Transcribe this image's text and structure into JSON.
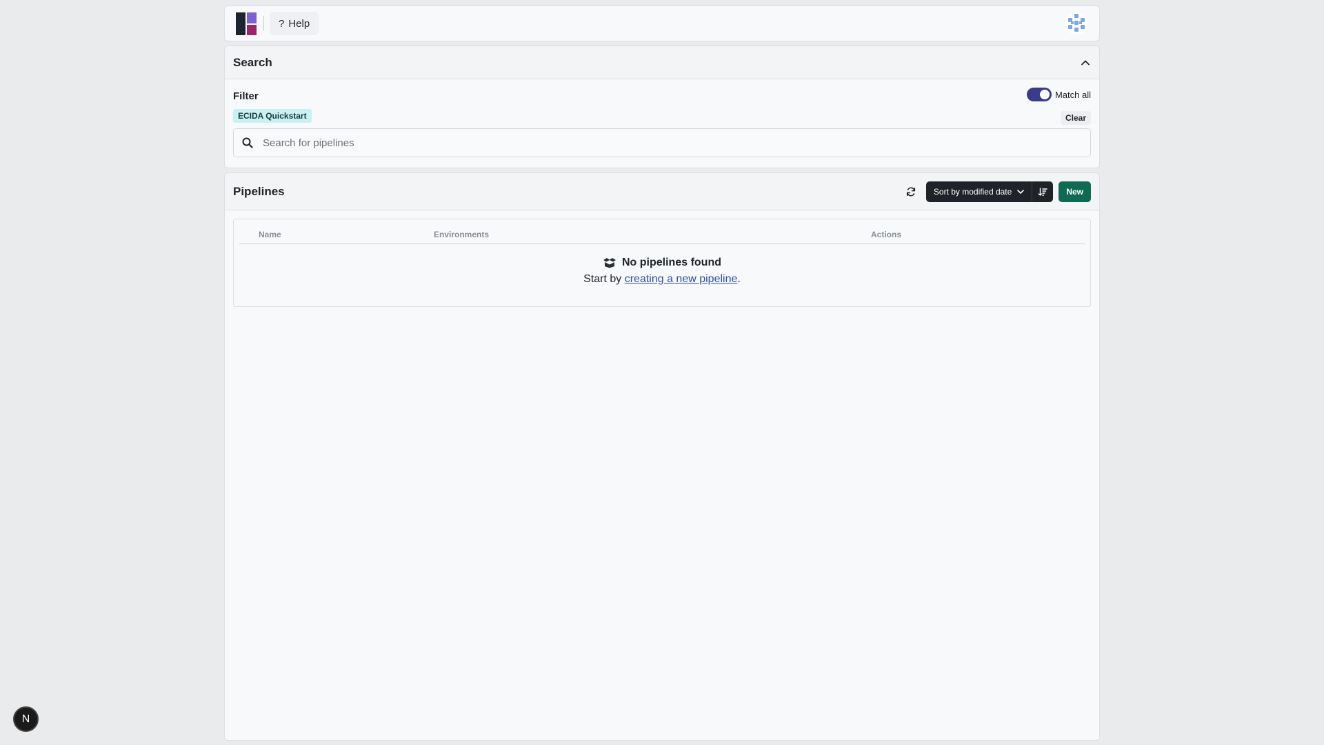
{
  "topbar": {
    "help_label": "Help",
    "help_icon": "?"
  },
  "search_panel": {
    "title": "Search",
    "filter_label": "Filter",
    "match_all_label": "Match all",
    "match_all_on": true,
    "tags": [
      "ECIDA Quickstart"
    ],
    "clear_label": "Clear",
    "search_placeholder": "Search for pipelines"
  },
  "pipelines_panel": {
    "title": "Pipelines",
    "sort_label": "Sort by modified date",
    "new_label": "New",
    "columns": [
      "Name",
      "Environments",
      "Actions"
    ],
    "empty_title": "No pipelines found",
    "empty_prefix": "Start by ",
    "empty_link": "creating a new pipeline",
    "empty_suffix": "."
  },
  "fab": {
    "label": "N"
  },
  "colors": {
    "accent": "#3b3b8c",
    "new_button": "#0e6a52",
    "tag_bg": "#c8f2f1",
    "logo_purple": "#7b61d6",
    "logo_magenta": "#a0246a"
  }
}
